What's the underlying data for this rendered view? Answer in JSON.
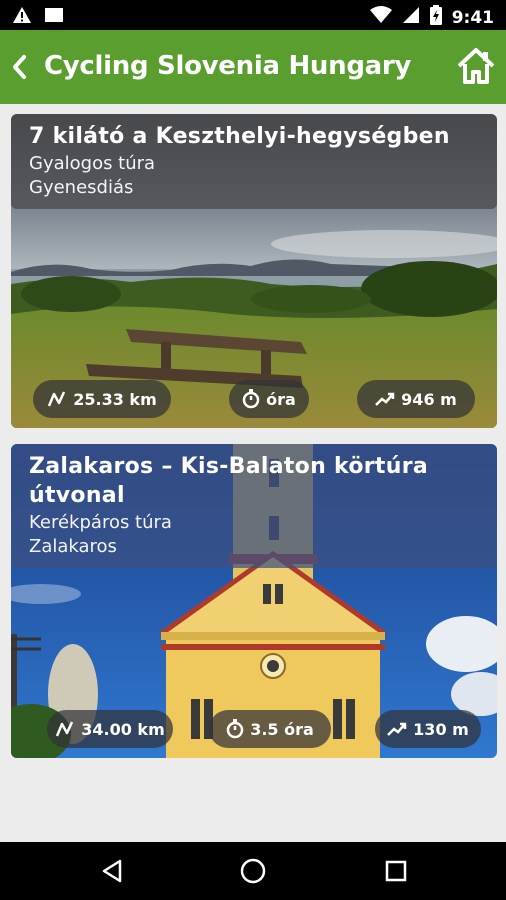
{
  "status_bar": {
    "time": "9:41",
    "icons": [
      "warning-icon",
      "notification-icon",
      "wifi-icon",
      "signal-icon",
      "battery-icon"
    ]
  },
  "app_bar": {
    "title": "Cycling Slovenia Hungary",
    "back_icon": "chevron-left-icon",
    "home_icon": "home-icon",
    "color": "#5a9e2f"
  },
  "tours": [
    {
      "title": "7 kilátó a Keszthelyi-hegységben",
      "type": "Gyalogos túra",
      "location": "Gyenesdiás",
      "distance": "25.33 km",
      "duration": "óra",
      "elevation": "946 m"
    },
    {
      "title": "Zalakaros – Kis-Balaton körtúra útvonal",
      "type": "Kerékpáros túra",
      "location": "Zalakaros",
      "distance": "34.00 km",
      "duration": "3.5 óra",
      "elevation": "130 m"
    }
  ],
  "nav_bar": {
    "icons": [
      "back-triangle-icon",
      "home-circle-icon",
      "recents-square-icon"
    ]
  }
}
